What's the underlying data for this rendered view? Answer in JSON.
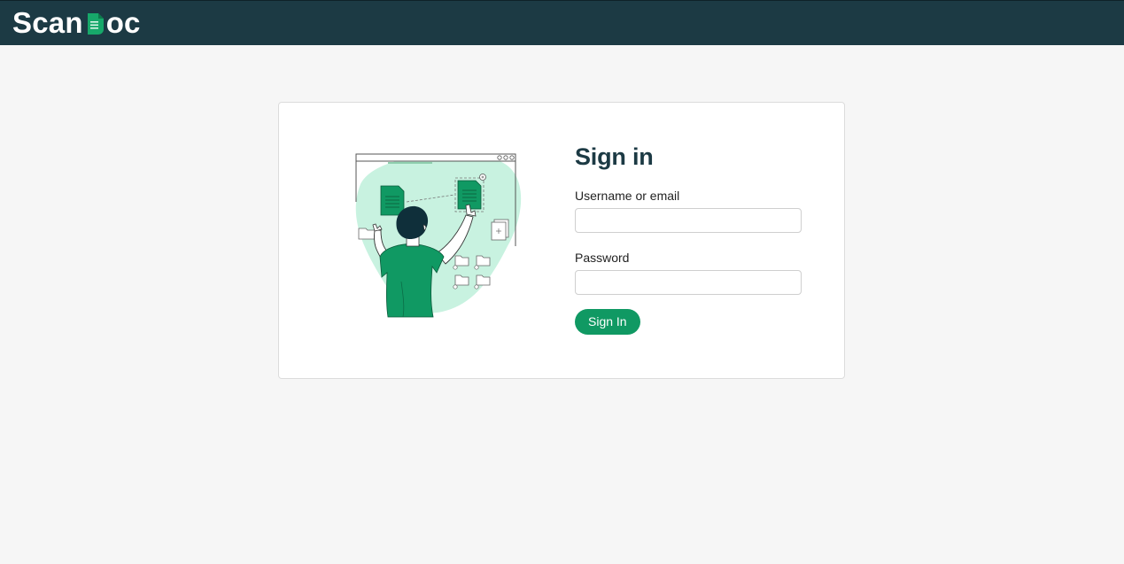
{
  "header": {
    "logo_prefix": "Scan",
    "logo_suffix": "oc",
    "colors": {
      "bar": "#1c3a44",
      "accent": "#109963"
    }
  },
  "illustration": {
    "icon": "person-organizing-documents-illustration"
  },
  "signin": {
    "title": "Sign in",
    "username_label": "Username or email",
    "username_value": "",
    "password_label": "Password",
    "password_value": "",
    "submit_label": "Sign In"
  }
}
